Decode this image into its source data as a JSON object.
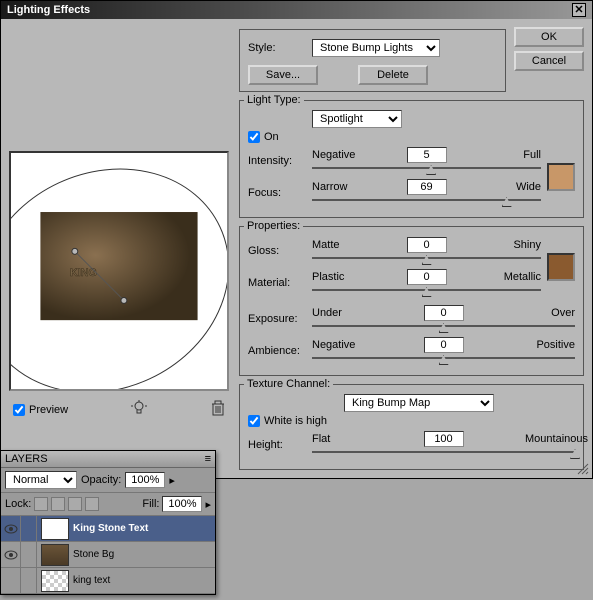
{
  "dialog": {
    "title": "Lighting Effects",
    "ok": "OK",
    "cancel": "Cancel",
    "save": "Save...",
    "delete": "Delete"
  },
  "style": {
    "label": "Style:",
    "value": "Stone Bump Lights"
  },
  "light_type": {
    "legend": "Light Type:",
    "value": "Spotlight",
    "on_label": "On",
    "on_checked": true,
    "intensity": {
      "label": "Intensity:",
      "low": "Negative",
      "high": "Full",
      "value": "5",
      "pos": 52
    },
    "focus": {
      "label": "Focus:",
      "low": "Narrow",
      "high": "Wide",
      "value": "69",
      "pos": 85
    },
    "swatch": "#c89768"
  },
  "properties": {
    "legend": "Properties:",
    "gloss": {
      "label": "Gloss:",
      "low": "Matte",
      "high": "Shiny",
      "value": "0",
      "pos": 50
    },
    "material": {
      "label": "Material:",
      "low": "Plastic",
      "high": "Metallic",
      "value": "0",
      "pos": 50
    },
    "exposure": {
      "label": "Exposure:",
      "low": "Under",
      "high": "Over",
      "value": "0",
      "pos": 50
    },
    "ambience": {
      "label": "Ambience:",
      "low": "Negative",
      "high": "Positive",
      "value": "0",
      "pos": 50
    },
    "swatch": "#8a5a2f"
  },
  "texture": {
    "legend": "Texture Channel:",
    "value": "King Bump Map",
    "white_high_label": "White is high",
    "white_high_checked": true,
    "height": {
      "label": "Height:",
      "low": "Flat",
      "high": "Mountainous",
      "value": "100",
      "pos": 100
    }
  },
  "preview": {
    "checkbox_label": "Preview",
    "checked": true
  },
  "layers": {
    "title": "LAYERS",
    "blend_mode": "Normal",
    "opacity_label": "Opacity:",
    "opacity_value": "100%",
    "lock_label": "Lock:",
    "fill_label": "Fill:",
    "fill_value": "100%",
    "items": [
      {
        "name": "King Stone Text",
        "thumb": "white",
        "visible": true,
        "selected": true
      },
      {
        "name": "Stone Bg",
        "thumb": "stone",
        "visible": true,
        "selected": false
      },
      {
        "name": "king text",
        "thumb": "transp",
        "visible": false,
        "selected": false
      }
    ]
  }
}
